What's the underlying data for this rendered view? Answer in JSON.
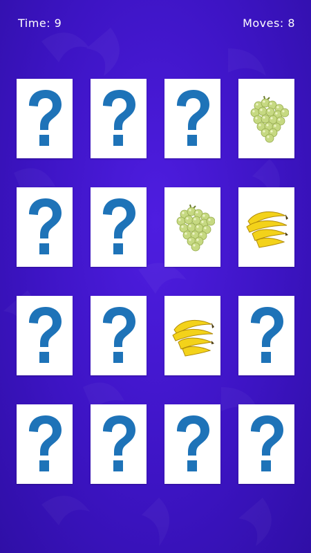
{
  "hud": {
    "time_label": "Time",
    "time_value": "9",
    "moves_label": "Moves",
    "moves_value": "8"
  },
  "colors": {
    "background": "#3d14c4",
    "card_back_symbol": "#1e73b8",
    "card_face": "#ffffff"
  },
  "board": {
    "rows": 4,
    "cols": 4,
    "cards": [
      "hidden",
      "hidden",
      "hidden",
      "grapes",
      "hidden",
      "hidden",
      "grapes",
      "bananas",
      "hidden",
      "hidden",
      "bananas",
      "hidden",
      "hidden",
      "hidden",
      "hidden",
      "hidden"
    ]
  }
}
